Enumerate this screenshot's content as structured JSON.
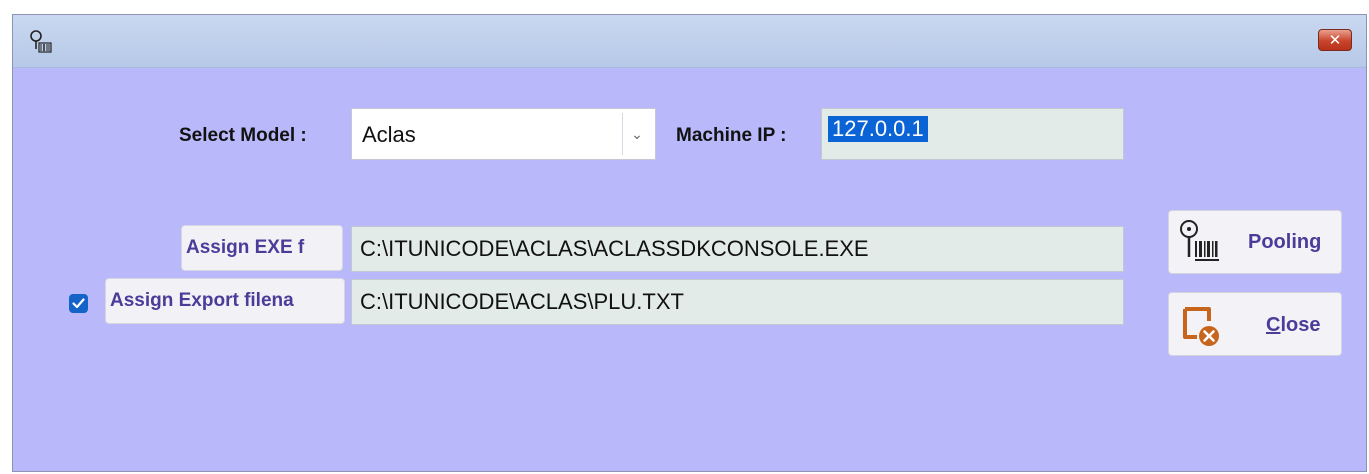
{
  "window": {
    "title": "",
    "close_glyph": "✕",
    "icon": "scale-keyhole-icon"
  },
  "form": {
    "model_label": "Select Model :",
    "model_value": "Aclas",
    "ip_label": "Machine IP :",
    "ip_value": "127.0.0.1",
    "exe_button": "Assign EXE f",
    "exe_path": "C:\\ITUNICODE\\ACLAS\\ACLASSDKCONSOLE.EXE",
    "export_checked": true,
    "export_button": "Assign Export filena",
    "export_path": "C:\\ITUNICODE\\ACLAS\\PLU.TXT"
  },
  "actions": {
    "pooling_label": "Pooling",
    "pooling_icon": "barcode-scale-icon",
    "close_mnemonic": "C",
    "close_rest": "lose",
    "close_icon": "window-close-icon"
  },
  "colors": {
    "form_bg": "#b8b8fb",
    "button_text": "#4b3c9a",
    "selection": "#0a64d6",
    "close_icon": "#c8651c"
  }
}
